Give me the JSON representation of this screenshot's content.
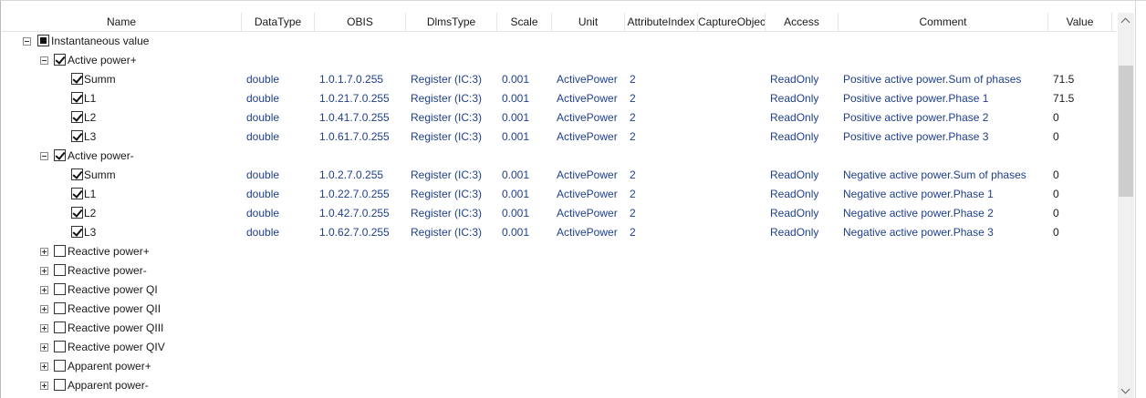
{
  "columns": [
    "Name",
    "DataType",
    "OBIS",
    "DlmsType",
    "Scale",
    "Unit",
    "AttributeIndex",
    "CaptureObjec",
    "Access",
    "Comment",
    "Value"
  ],
  "root": {
    "label": "Instantaneous value",
    "state": "indeterminate",
    "expanded": true
  },
  "groups": [
    {
      "label": "Active power+",
      "checked": true,
      "expanded": true,
      "children": [
        {
          "name": "Summ",
          "datatype": "double",
          "obis": "1.0.1.7.0.255",
          "dlms": "Register (IC:3)",
          "scale": "0.001",
          "unit": "ActivePower",
          "attr": "2",
          "capture": "",
          "access": "ReadOnly",
          "comment": "Positive active power.Sum of phases",
          "value": "71.5"
        },
        {
          "name": "L1",
          "datatype": "double",
          "obis": "1.0.21.7.0.255",
          "dlms": "Register (IC:3)",
          "scale": "0.001",
          "unit": "ActivePower",
          "attr": "2",
          "capture": "",
          "access": "ReadOnly",
          "comment": "Positive active power.Phase 1",
          "value": "71.5"
        },
        {
          "name": "L2",
          "datatype": "double",
          "obis": "1.0.41.7.0.255",
          "dlms": "Register (IC:3)",
          "scale": "0.001",
          "unit": "ActivePower",
          "attr": "2",
          "capture": "",
          "access": "ReadOnly",
          "comment": "Positive active power.Phase 2",
          "value": "0"
        },
        {
          "name": "L3",
          "datatype": "double",
          "obis": "1.0.61.7.0.255",
          "dlms": "Register (IC:3)",
          "scale": "0.001",
          "unit": "ActivePower",
          "attr": "2",
          "capture": "",
          "access": "ReadOnly",
          "comment": "Positive active power.Phase 3",
          "value": "0"
        }
      ]
    },
    {
      "label": "Active power-",
      "checked": true,
      "expanded": true,
      "children": [
        {
          "name": "Summ",
          "datatype": "double",
          "obis": "1.0.2.7.0.255",
          "dlms": "Register (IC:3)",
          "scale": "0.001",
          "unit": "ActivePower",
          "attr": "2",
          "capture": "",
          "access": "ReadOnly",
          "comment": "Negative active power.Sum of phases",
          "value": "0"
        },
        {
          "name": "L1",
          "datatype": "double",
          "obis": "1.0.22.7.0.255",
          "dlms": "Register (IC:3)",
          "scale": "0.001",
          "unit": "ActivePower",
          "attr": "2",
          "capture": "",
          "access": "ReadOnly",
          "comment": "Negative active power.Phase 1",
          "value": "0"
        },
        {
          "name": "L2",
          "datatype": "double",
          "obis": "1.0.42.7.0.255",
          "dlms": "Register (IC:3)",
          "scale": "0.001",
          "unit": "ActivePower",
          "attr": "2",
          "capture": "",
          "access": "ReadOnly",
          "comment": "Negative active power.Phase 2",
          "value": "0"
        },
        {
          "name": "L3",
          "datatype": "double",
          "obis": "1.0.62.7.0.255",
          "dlms": "Register (IC:3)",
          "scale": "0.001",
          "unit": "ActivePower",
          "attr": "2",
          "capture": "",
          "access": "ReadOnly",
          "comment": "Negative active power.Phase 3",
          "value": "0"
        }
      ]
    },
    {
      "label": "Reactive power+",
      "checked": false,
      "expanded": false,
      "children": []
    },
    {
      "label": "Reactive power-",
      "checked": false,
      "expanded": false,
      "children": []
    },
    {
      "label": "Reactive power QI",
      "checked": false,
      "expanded": false,
      "children": []
    },
    {
      "label": "Reactive power QII",
      "checked": false,
      "expanded": false,
      "children": []
    },
    {
      "label": "Reactive power QIII",
      "checked": false,
      "expanded": false,
      "children": []
    },
    {
      "label": "Reactive power QIV",
      "checked": false,
      "expanded": false,
      "children": []
    },
    {
      "label": "Apparent power+",
      "checked": false,
      "expanded": false,
      "children": []
    },
    {
      "label": "Apparent power-",
      "checked": false,
      "expanded": false,
      "children": []
    }
  ],
  "colors": {
    "text": "#1a1a1a",
    "value_text": "#1f3f8c",
    "scroll_track": "#f0f0f0",
    "scroll_thumb": "#cdcdcd"
  },
  "icons": {
    "expand": "plus-box-icon",
    "collapse": "minus-box-icon",
    "scroll_up": "chevron-up-icon",
    "scroll_down": "chevron-down-icon"
  }
}
